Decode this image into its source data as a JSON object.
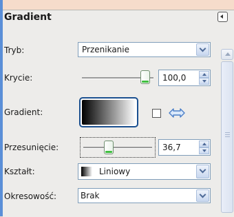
{
  "panel": {
    "title": "Gradient"
  },
  "fields": {
    "tryb": {
      "label": "Tryb:",
      "value": "Przenikanie"
    },
    "krycie": {
      "label": "Krycie:",
      "value": "100,0",
      "level": 1.0
    },
    "gradient": {
      "label": "Gradient:"
    },
    "przesuniecie": {
      "label": "Przesunięcie:",
      "value": "36,7",
      "level": 0.367
    },
    "ksztalt": {
      "label": "Kształt:",
      "value": "Liniowy"
    },
    "okresowosc": {
      "label": "Okresowość:",
      "value": "Brak"
    }
  },
  "colors": {
    "accent": "#1a4f8f",
    "slider_indicator": "#3fbf3f",
    "border_blue": "#7f9db9"
  },
  "icons": {
    "collapse": "collapse-left-icon",
    "swap": "swap-arrows-icon",
    "dropdown": "chevron-down-icon"
  }
}
